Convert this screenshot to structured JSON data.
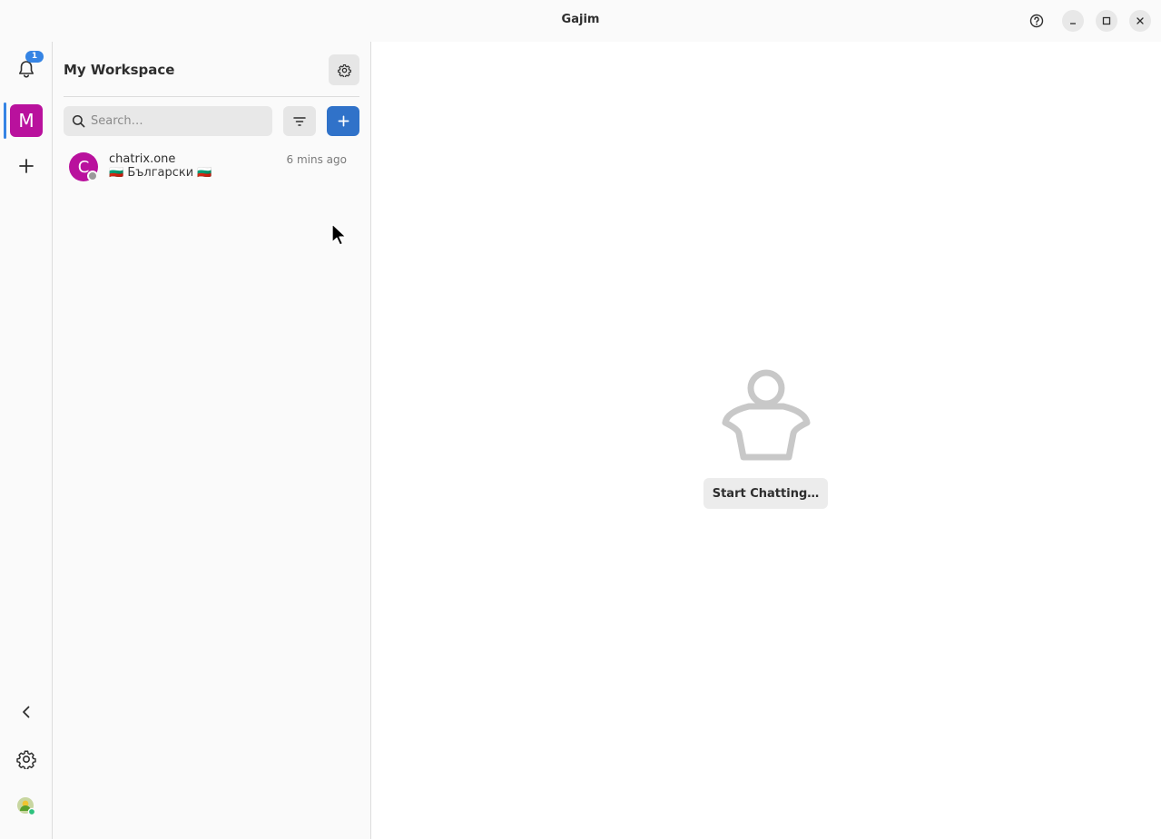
{
  "window": {
    "title": "Gajim"
  },
  "titlebar": {
    "help_icon": "help-circle-icon",
    "minimize_icon": "minimize-icon",
    "maximize_icon": "maximize-icon",
    "close_icon": "close-icon"
  },
  "rail": {
    "notification_count": "1",
    "workspace_initial": "M",
    "workspace_color": "#b9119d",
    "accent_color": "#3584e4"
  },
  "sidebar": {
    "workspace_name": "My Workspace",
    "search": {
      "placeholder": "Search…",
      "value": ""
    },
    "chats": [
      {
        "initial": "C",
        "name": "chatrix.one",
        "time": "6 mins ago",
        "preview": "🇧🇬 Български 🇧🇬",
        "avatar_color": "#b9119d"
      }
    ]
  },
  "main": {
    "start_button_label": "Start Chatting…"
  }
}
